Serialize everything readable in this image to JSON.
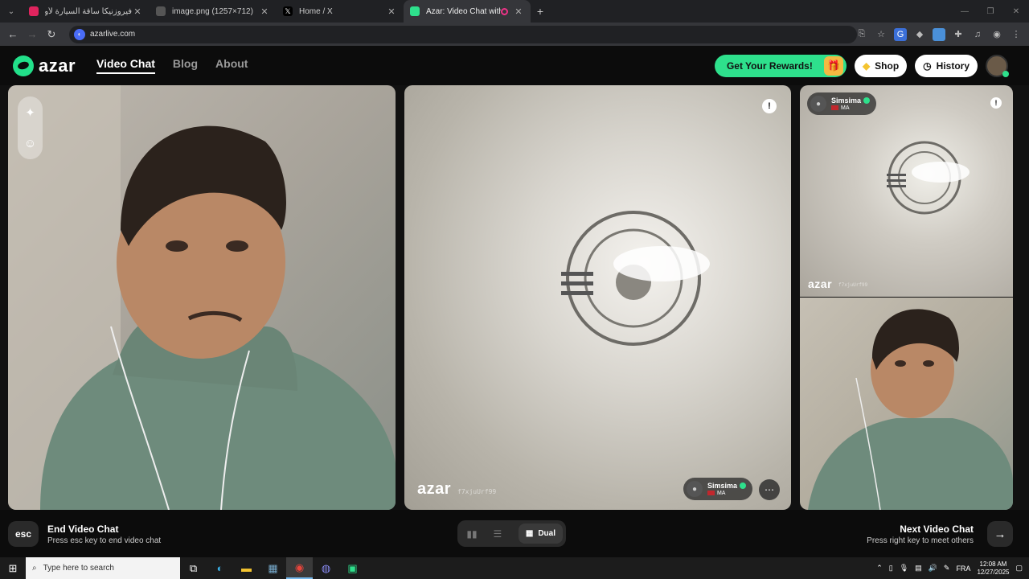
{
  "browser": {
    "tabs": [
      {
        "title": "فيروزنيكا ساقة السيارة لأول مرة فـ",
        "favicon_color": "#e0245e"
      },
      {
        "title": "image.png (1257×712)",
        "favicon_color": "#555555"
      },
      {
        "title": "Home / X",
        "favicon_color": "#000000"
      },
      {
        "title": "Azar: Video Chat with New",
        "favicon_color": "#2ee08c",
        "active": true
      }
    ],
    "url": "azarlive.com"
  },
  "site": {
    "logo_text": "azar",
    "nav": [
      {
        "label": "Video Chat",
        "active": true
      },
      {
        "label": "Blog"
      },
      {
        "label": "About"
      }
    ],
    "rewards_label": "Get Your Rewards!",
    "shop_label": "Shop",
    "history_label": "History",
    "accent": "#2ee08c"
  },
  "video": {
    "remote_user": {
      "name": "Simsima",
      "country": "MA"
    },
    "watermark_brand": "azar",
    "watermark_code": "f7xjuUrf99"
  },
  "controls": {
    "esc_label": "esc",
    "end_title": "End Video Chat",
    "end_subtitle": "Press esc key to end video chat",
    "layout_mode": "Dual",
    "next_title": "Next Video Chat",
    "next_subtitle": "Press right key to meet others"
  },
  "taskbar": {
    "search_placeholder": "Type here to search",
    "language": "FRA",
    "time": "12:08 AM",
    "date": "12/27/2025"
  }
}
